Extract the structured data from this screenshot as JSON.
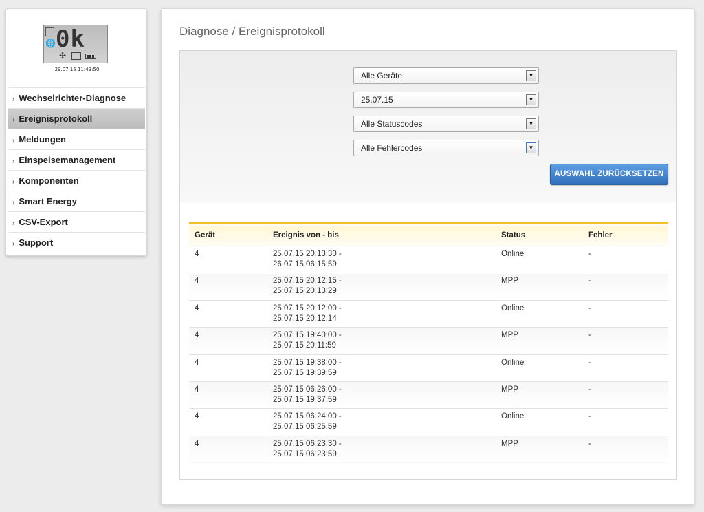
{
  "device": {
    "display_text": "0k",
    "timestamp": "29.07.15 11:43:50"
  },
  "sidebar": {
    "items": [
      {
        "label": "Wechselrichter-Diagnose",
        "active": false
      },
      {
        "label": "Ereignisprotokoll",
        "active": true
      },
      {
        "label": "Meldungen",
        "active": false
      },
      {
        "label": "Einspeisemanagement",
        "active": false
      },
      {
        "label": "Komponenten",
        "active": false
      },
      {
        "label": "Smart Energy",
        "active": false
      },
      {
        "label": "CSV-Export",
        "active": false
      },
      {
        "label": "Support",
        "active": false
      }
    ]
  },
  "main": {
    "title": "Diagnose / Ereignisprotokoll",
    "filters": {
      "device": "Alle Geräte",
      "date": "25.07.15",
      "status": "Alle Statuscodes",
      "error": "Alle Fehlercodes"
    },
    "reset_label": "AUSWAHL ZURÜCKSETZEN",
    "table": {
      "headers": [
        "Gerät",
        "Ereignis von - bis",
        "Status",
        "Fehler"
      ],
      "rows": [
        {
          "device": "4",
          "from": "25.07.15 20:13:30 -",
          "to": "26.07.15 06:15:59",
          "status": "Online",
          "error": "-"
        },
        {
          "device": "4",
          "from": "25.07.15 20:12:15 -",
          "to": "25.07.15 20:13:29",
          "status": "MPP",
          "error": "-"
        },
        {
          "device": "4",
          "from": "25.07.15 20:12:00 -",
          "to": "25.07.15 20:12:14",
          "status": "Online",
          "error": "-"
        },
        {
          "device": "4",
          "from": "25.07.15 19:40:00 -",
          "to": "25.07.15 20:11:59",
          "status": "MPP",
          "error": "-"
        },
        {
          "device": "4",
          "from": "25.07.15 19:38:00 -",
          "to": "25.07.15 19:39:59",
          "status": "Online",
          "error": "-"
        },
        {
          "device": "4",
          "from": "25.07.15 06:26:00 -",
          "to": "25.07.15 19:37:59",
          "status": "MPP",
          "error": "-"
        },
        {
          "device": "4",
          "from": "25.07.15 06:24:00 -",
          "to": "25.07.15 06:25:59",
          "status": "Online",
          "error": "-"
        },
        {
          "device": "4",
          "from": "25.07.15 06:23:30 -",
          "to": "25.07.15 06:23:59",
          "status": "MPP",
          "error": "-"
        }
      ]
    }
  },
  "colors": {
    "button": "#2f6fba",
    "table_header_accent": "#f2c12a",
    "active_nav": "#c4c4c4"
  }
}
